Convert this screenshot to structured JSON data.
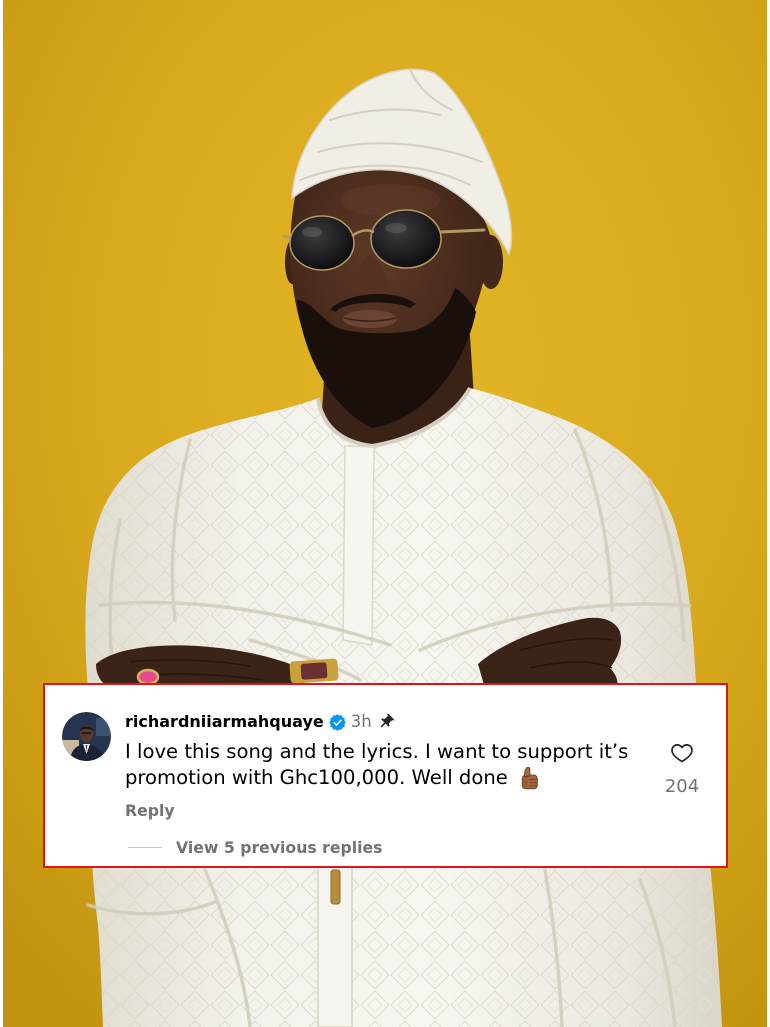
{
  "comment": {
    "avatar_icon": "profile-avatar",
    "username": "richardniiarmahquaye",
    "verified_icon": "verified-badge-icon",
    "timestamp": "3h",
    "pin_icon": "pin-icon",
    "text_lines": [
      "I love this song and the lyrics. I want to support it’s",
      "promotion with Ghc100,000. Well done"
    ],
    "emoji_icon": "thumbs-up-medium-dark-skin-icon",
    "like_icon": "heart-outline-icon",
    "like_count": "204",
    "reply_label": "Reply",
    "view_replies_label": "View 5 previous replies"
  },
  "colors": {
    "highlight_border": "#e0141d",
    "verified_blue": "#0095f6",
    "muted_text": "#737373",
    "primary_text": "#000000",
    "icon_dark": "#262626",
    "photo_background": "#d8a91c"
  }
}
